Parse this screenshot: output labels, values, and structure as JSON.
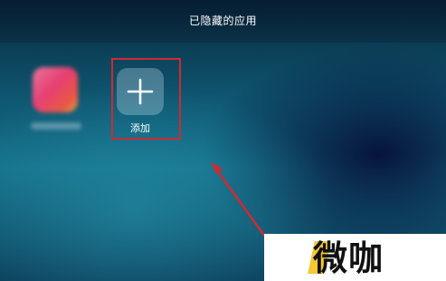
{
  "header": {
    "title": "已隐藏的应用"
  },
  "apps": {
    "hidden_app_icon": "blurred-app-icon",
    "add_tile": {
      "icon": "plus-icon",
      "label": "添加"
    }
  },
  "annotation": {
    "highlight_color": "#cf2a2f",
    "arrow_color": "#cf2a2f"
  },
  "watermark": {
    "text": "微咖",
    "accent_color": "#f4c21e"
  }
}
